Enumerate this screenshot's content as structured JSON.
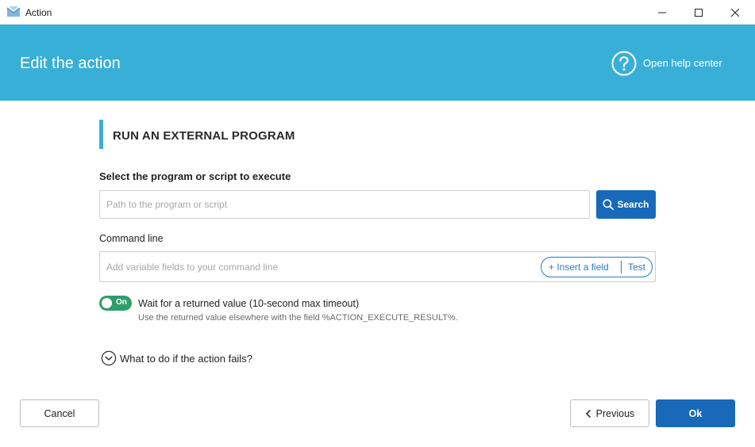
{
  "window": {
    "title": "Action",
    "app_icon": "envelope-app-icon",
    "controls": [
      "minimize-icon",
      "maximize-icon",
      "close-icon"
    ]
  },
  "header": {
    "title": "Edit the action",
    "help_label": "Open help center",
    "help_icon": "question-circle-icon",
    "background_color": "#38afd7"
  },
  "section": {
    "title": "RUN AN EXTERNAL PROGRAM",
    "accent_color": "#38afd7"
  },
  "program": {
    "label": "Select the program or script to execute",
    "value": "",
    "placeholder": "Path to the program or script",
    "search_label": "Search",
    "search_icon": "search-icon"
  },
  "command_line": {
    "label": "Command line",
    "value": "",
    "placeholder": "Add variable fields to your command line",
    "insert_label": "+ Insert a field",
    "test_label": "Test"
  },
  "wait": {
    "toggle_state": "On",
    "enabled": true,
    "label": "Wait for a returned value (10-second max timeout)",
    "hint": "Use the returned value elsewhere with the field %ACTION_EXECUTE_RESULT%.",
    "toggle_color": "#2e9e6a"
  },
  "failure": {
    "label": "What to do if the action fails?",
    "icon": "chevron-down-circle-icon"
  },
  "footer": {
    "cancel_label": "Cancel",
    "previous_label": "Previous",
    "previous_icon": "chevron-left-icon",
    "ok_label": "Ok",
    "primary_color": "#1869b9"
  }
}
